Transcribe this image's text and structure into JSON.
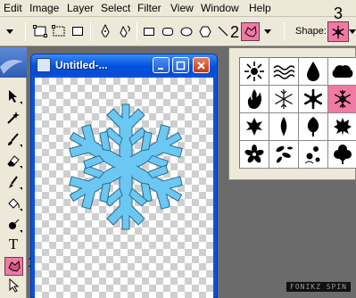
{
  "menu": [
    "Edit",
    "Image",
    "Layer",
    "Select",
    "Filter",
    "View",
    "Window",
    "Help"
  ],
  "options_bar": {
    "shape_label": "Shape:",
    "callout_2": "2",
    "callout_3": "3",
    "selected_shape_icon": "snowflake-icon"
  },
  "tools": {
    "type_tool_label": "T",
    "callout_1": "1",
    "active_tool_icon": "custom-shape-icon"
  },
  "document": {
    "title": "Untitled-...",
    "shape_icon": "snowflake-icon",
    "shape_color": "#6cc8f2",
    "canvas": "transparent-checkerboard"
  },
  "shape_picker": {
    "shapes": [
      "sun-icon",
      "waves-icon",
      "raindrop-icon",
      "cloud-icon",
      "fire-icon",
      "snowflake-outline-icon",
      "snowflake-solid-icon",
      "snowflake-selected-icon",
      "leaf-icon",
      "fern-leaf-icon",
      "maple-leaf-icon",
      "oak-leaf-icon",
      "flower-icon",
      "leaf-scatter-icon",
      "flower-scatter-icon",
      "clover-icon"
    ],
    "selected_index": 7
  },
  "watermark": "FONIKZ SPIN",
  "colors": {
    "selection_pink": "#f07aa4",
    "titlebar_blue": "#0a52dd",
    "workspace_gray": "#6b6b6b"
  }
}
